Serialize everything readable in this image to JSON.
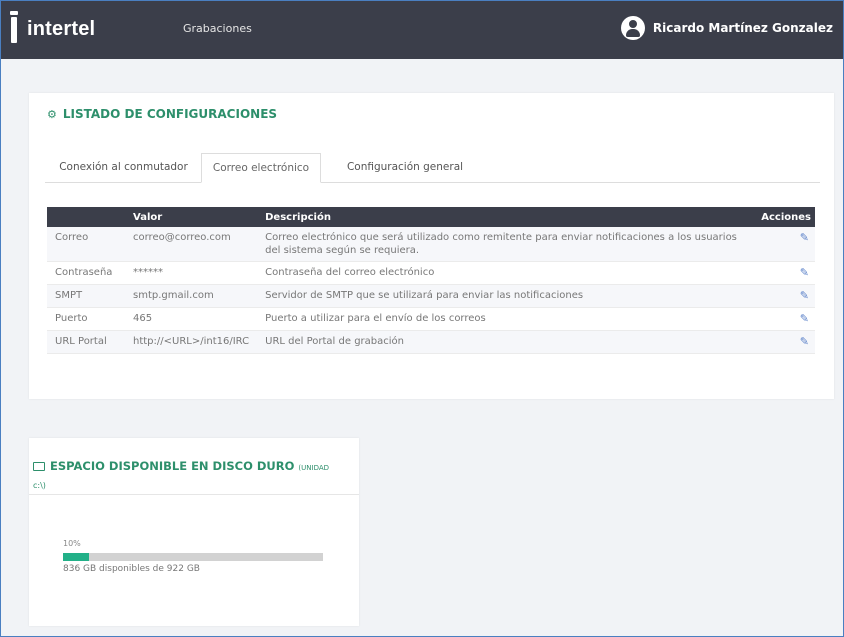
{
  "header": {
    "brand": "intertel",
    "nav_link": "Grabaciones",
    "user_name": "Ricardo Martínez Gonzalez"
  },
  "config_card": {
    "title": "LISTADO DE CONFIGURACIONES",
    "tabs": [
      {
        "label": "Conexión al conmutador",
        "active": false
      },
      {
        "label": "Correo electrónico",
        "active": true
      },
      {
        "label": "Configuración general",
        "active": false
      }
    ],
    "table": {
      "headers": [
        "",
        "Valor",
        "Descripción",
        "Acciones"
      ],
      "rows": [
        {
          "name": "Correo",
          "value": "correo@correo.com",
          "description": "Correo electrónico que será utilizado como remitente para enviar notificaciones a los usuarios del sistema según se requiera."
        },
        {
          "name": "Contraseña",
          "value": "******",
          "description": "Contraseña del correo electrónico"
        },
        {
          "name": "SMPT",
          "value": "smtp.gmail.com",
          "description": "Servidor de SMTP que se utilizará para enviar las notificaciones"
        },
        {
          "name": "Puerto",
          "value": "465",
          "description": "Puerto a utilizar para el envío de los correos"
        },
        {
          "name": "URL Portal",
          "value": "http://<URL>/int16/IRC",
          "description": "URL del Portal de grabación"
        }
      ]
    }
  },
  "disk_card": {
    "title": "ESPACIO DISPONIBLE EN DISCO DURO",
    "unit_label": "(UNIDAD",
    "unit_drive": "c:\\)",
    "used_percent_label": "10%",
    "used_fraction": 0.1,
    "available_text": "836 GB disponibles de 922 GB"
  },
  "colors": {
    "topbar": "#3b3e4a",
    "accent": "#2d8f6b",
    "progress": "#22b088",
    "edit_icon": "#5a80c8"
  }
}
